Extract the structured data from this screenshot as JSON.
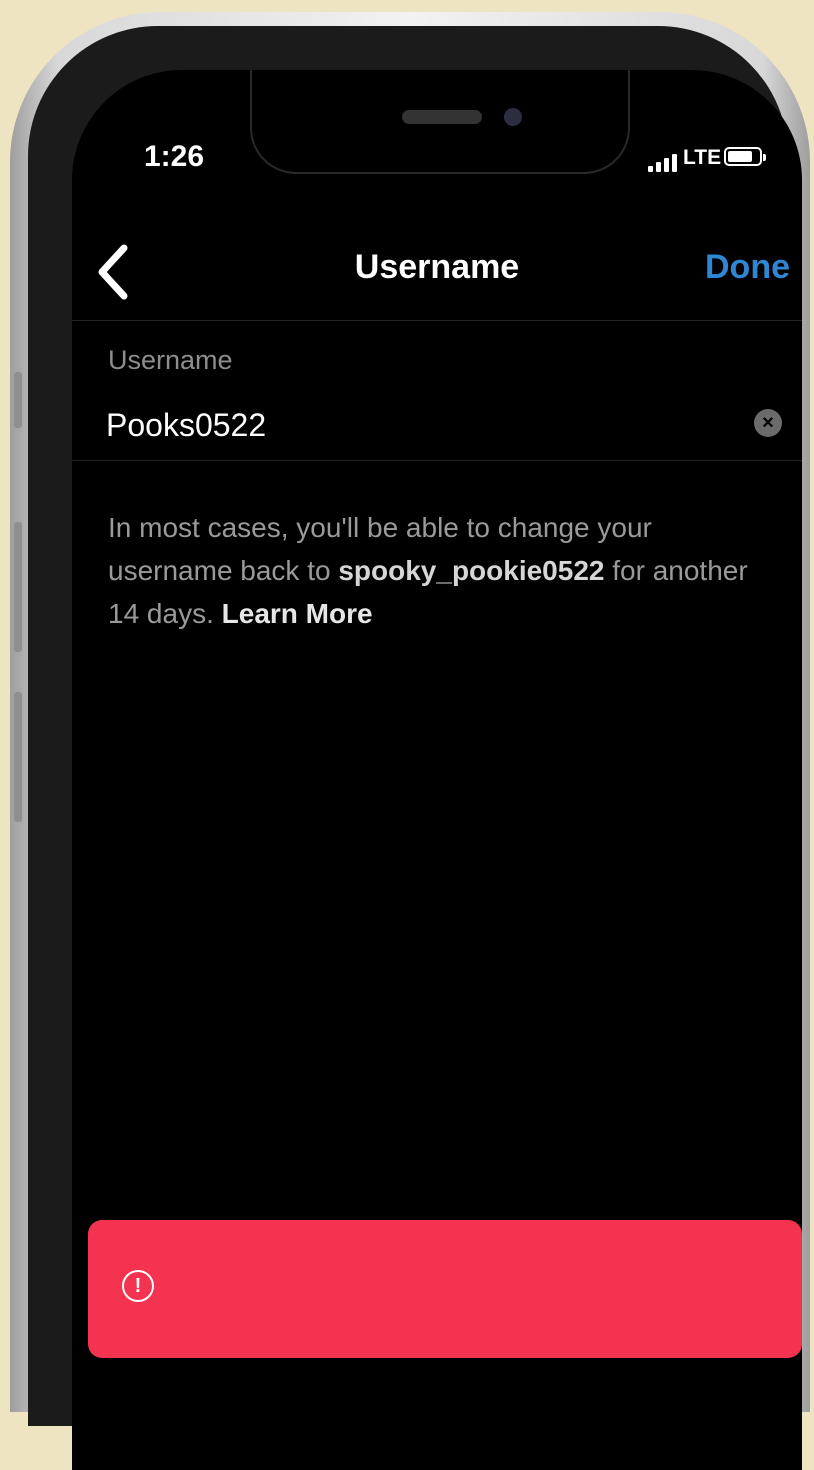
{
  "status_bar": {
    "time": "1:26",
    "network": "LTE",
    "battery_level": 0.8
  },
  "nav": {
    "back_icon": "chevron-left-icon",
    "title": "Username",
    "done_label": "Done"
  },
  "form": {
    "label": "Username",
    "value": "Pooks0522",
    "clear_icon": "clear-circle-icon"
  },
  "help": {
    "text_before": "In most cases, you'll be able to change your username back to ",
    "previous_username": "spooky_pookie0522",
    "text_after": " for another 14 days. ",
    "link_label": "Learn More"
  },
  "alert": {
    "icon": "alert-circle-icon",
    "glyph": "!",
    "message": "",
    "color": "#f43350"
  },
  "colors": {
    "accent": "#2f87d4",
    "background": "#000000"
  }
}
